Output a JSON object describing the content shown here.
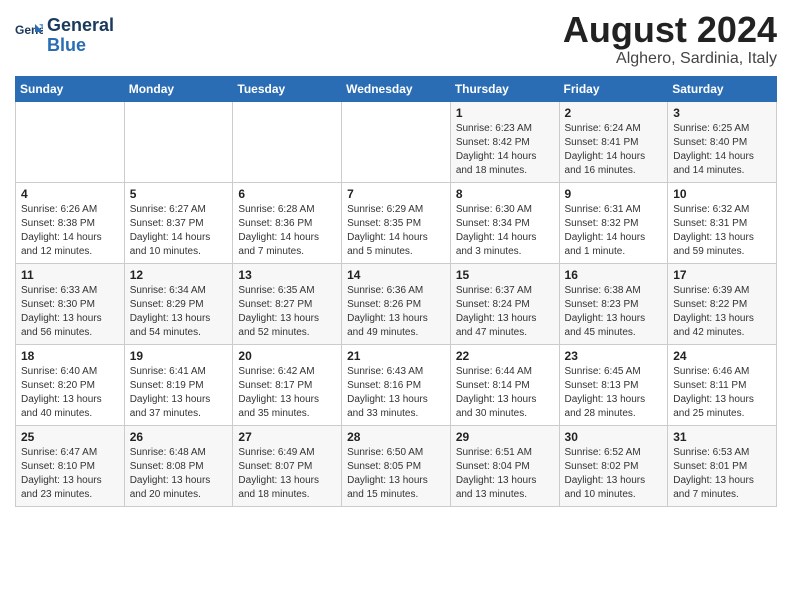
{
  "logo": {
    "line1": "General",
    "line2": "Blue"
  },
  "title": "August 2024",
  "subtitle": "Alghero, Sardinia, Italy",
  "weekdays": [
    "Sunday",
    "Monday",
    "Tuesday",
    "Wednesday",
    "Thursday",
    "Friday",
    "Saturday"
  ],
  "weeks": [
    [
      {
        "day": "",
        "info": ""
      },
      {
        "day": "",
        "info": ""
      },
      {
        "day": "",
        "info": ""
      },
      {
        "day": "",
        "info": ""
      },
      {
        "day": "1",
        "info": "Sunrise: 6:23 AM\nSunset: 8:42 PM\nDaylight: 14 hours\nand 18 minutes."
      },
      {
        "day": "2",
        "info": "Sunrise: 6:24 AM\nSunset: 8:41 PM\nDaylight: 14 hours\nand 16 minutes."
      },
      {
        "day": "3",
        "info": "Sunrise: 6:25 AM\nSunset: 8:40 PM\nDaylight: 14 hours\nand 14 minutes."
      }
    ],
    [
      {
        "day": "4",
        "info": "Sunrise: 6:26 AM\nSunset: 8:38 PM\nDaylight: 14 hours\nand 12 minutes."
      },
      {
        "day": "5",
        "info": "Sunrise: 6:27 AM\nSunset: 8:37 PM\nDaylight: 14 hours\nand 10 minutes."
      },
      {
        "day": "6",
        "info": "Sunrise: 6:28 AM\nSunset: 8:36 PM\nDaylight: 14 hours\nand 7 minutes."
      },
      {
        "day": "7",
        "info": "Sunrise: 6:29 AM\nSunset: 8:35 PM\nDaylight: 14 hours\nand 5 minutes."
      },
      {
        "day": "8",
        "info": "Sunrise: 6:30 AM\nSunset: 8:34 PM\nDaylight: 14 hours\nand 3 minutes."
      },
      {
        "day": "9",
        "info": "Sunrise: 6:31 AM\nSunset: 8:32 PM\nDaylight: 14 hours\nand 1 minute."
      },
      {
        "day": "10",
        "info": "Sunrise: 6:32 AM\nSunset: 8:31 PM\nDaylight: 13 hours\nand 59 minutes."
      }
    ],
    [
      {
        "day": "11",
        "info": "Sunrise: 6:33 AM\nSunset: 8:30 PM\nDaylight: 13 hours\nand 56 minutes."
      },
      {
        "day": "12",
        "info": "Sunrise: 6:34 AM\nSunset: 8:29 PM\nDaylight: 13 hours\nand 54 minutes."
      },
      {
        "day": "13",
        "info": "Sunrise: 6:35 AM\nSunset: 8:27 PM\nDaylight: 13 hours\nand 52 minutes."
      },
      {
        "day": "14",
        "info": "Sunrise: 6:36 AM\nSunset: 8:26 PM\nDaylight: 13 hours\nand 49 minutes."
      },
      {
        "day": "15",
        "info": "Sunrise: 6:37 AM\nSunset: 8:24 PM\nDaylight: 13 hours\nand 47 minutes."
      },
      {
        "day": "16",
        "info": "Sunrise: 6:38 AM\nSunset: 8:23 PM\nDaylight: 13 hours\nand 45 minutes."
      },
      {
        "day": "17",
        "info": "Sunrise: 6:39 AM\nSunset: 8:22 PM\nDaylight: 13 hours\nand 42 minutes."
      }
    ],
    [
      {
        "day": "18",
        "info": "Sunrise: 6:40 AM\nSunset: 8:20 PM\nDaylight: 13 hours\nand 40 minutes."
      },
      {
        "day": "19",
        "info": "Sunrise: 6:41 AM\nSunset: 8:19 PM\nDaylight: 13 hours\nand 37 minutes."
      },
      {
        "day": "20",
        "info": "Sunrise: 6:42 AM\nSunset: 8:17 PM\nDaylight: 13 hours\nand 35 minutes."
      },
      {
        "day": "21",
        "info": "Sunrise: 6:43 AM\nSunset: 8:16 PM\nDaylight: 13 hours\nand 33 minutes."
      },
      {
        "day": "22",
        "info": "Sunrise: 6:44 AM\nSunset: 8:14 PM\nDaylight: 13 hours\nand 30 minutes."
      },
      {
        "day": "23",
        "info": "Sunrise: 6:45 AM\nSunset: 8:13 PM\nDaylight: 13 hours\nand 28 minutes."
      },
      {
        "day": "24",
        "info": "Sunrise: 6:46 AM\nSunset: 8:11 PM\nDaylight: 13 hours\nand 25 minutes."
      }
    ],
    [
      {
        "day": "25",
        "info": "Sunrise: 6:47 AM\nSunset: 8:10 PM\nDaylight: 13 hours\nand 23 minutes."
      },
      {
        "day": "26",
        "info": "Sunrise: 6:48 AM\nSunset: 8:08 PM\nDaylight: 13 hours\nand 20 minutes."
      },
      {
        "day": "27",
        "info": "Sunrise: 6:49 AM\nSunset: 8:07 PM\nDaylight: 13 hours\nand 18 minutes."
      },
      {
        "day": "28",
        "info": "Sunrise: 6:50 AM\nSunset: 8:05 PM\nDaylight: 13 hours\nand 15 minutes."
      },
      {
        "day": "29",
        "info": "Sunrise: 6:51 AM\nSunset: 8:04 PM\nDaylight: 13 hours\nand 13 minutes."
      },
      {
        "day": "30",
        "info": "Sunrise: 6:52 AM\nSunset: 8:02 PM\nDaylight: 13 hours\nand 10 minutes."
      },
      {
        "day": "31",
        "info": "Sunrise: 6:53 AM\nSunset: 8:01 PM\nDaylight: 13 hours\nand 7 minutes."
      }
    ]
  ]
}
